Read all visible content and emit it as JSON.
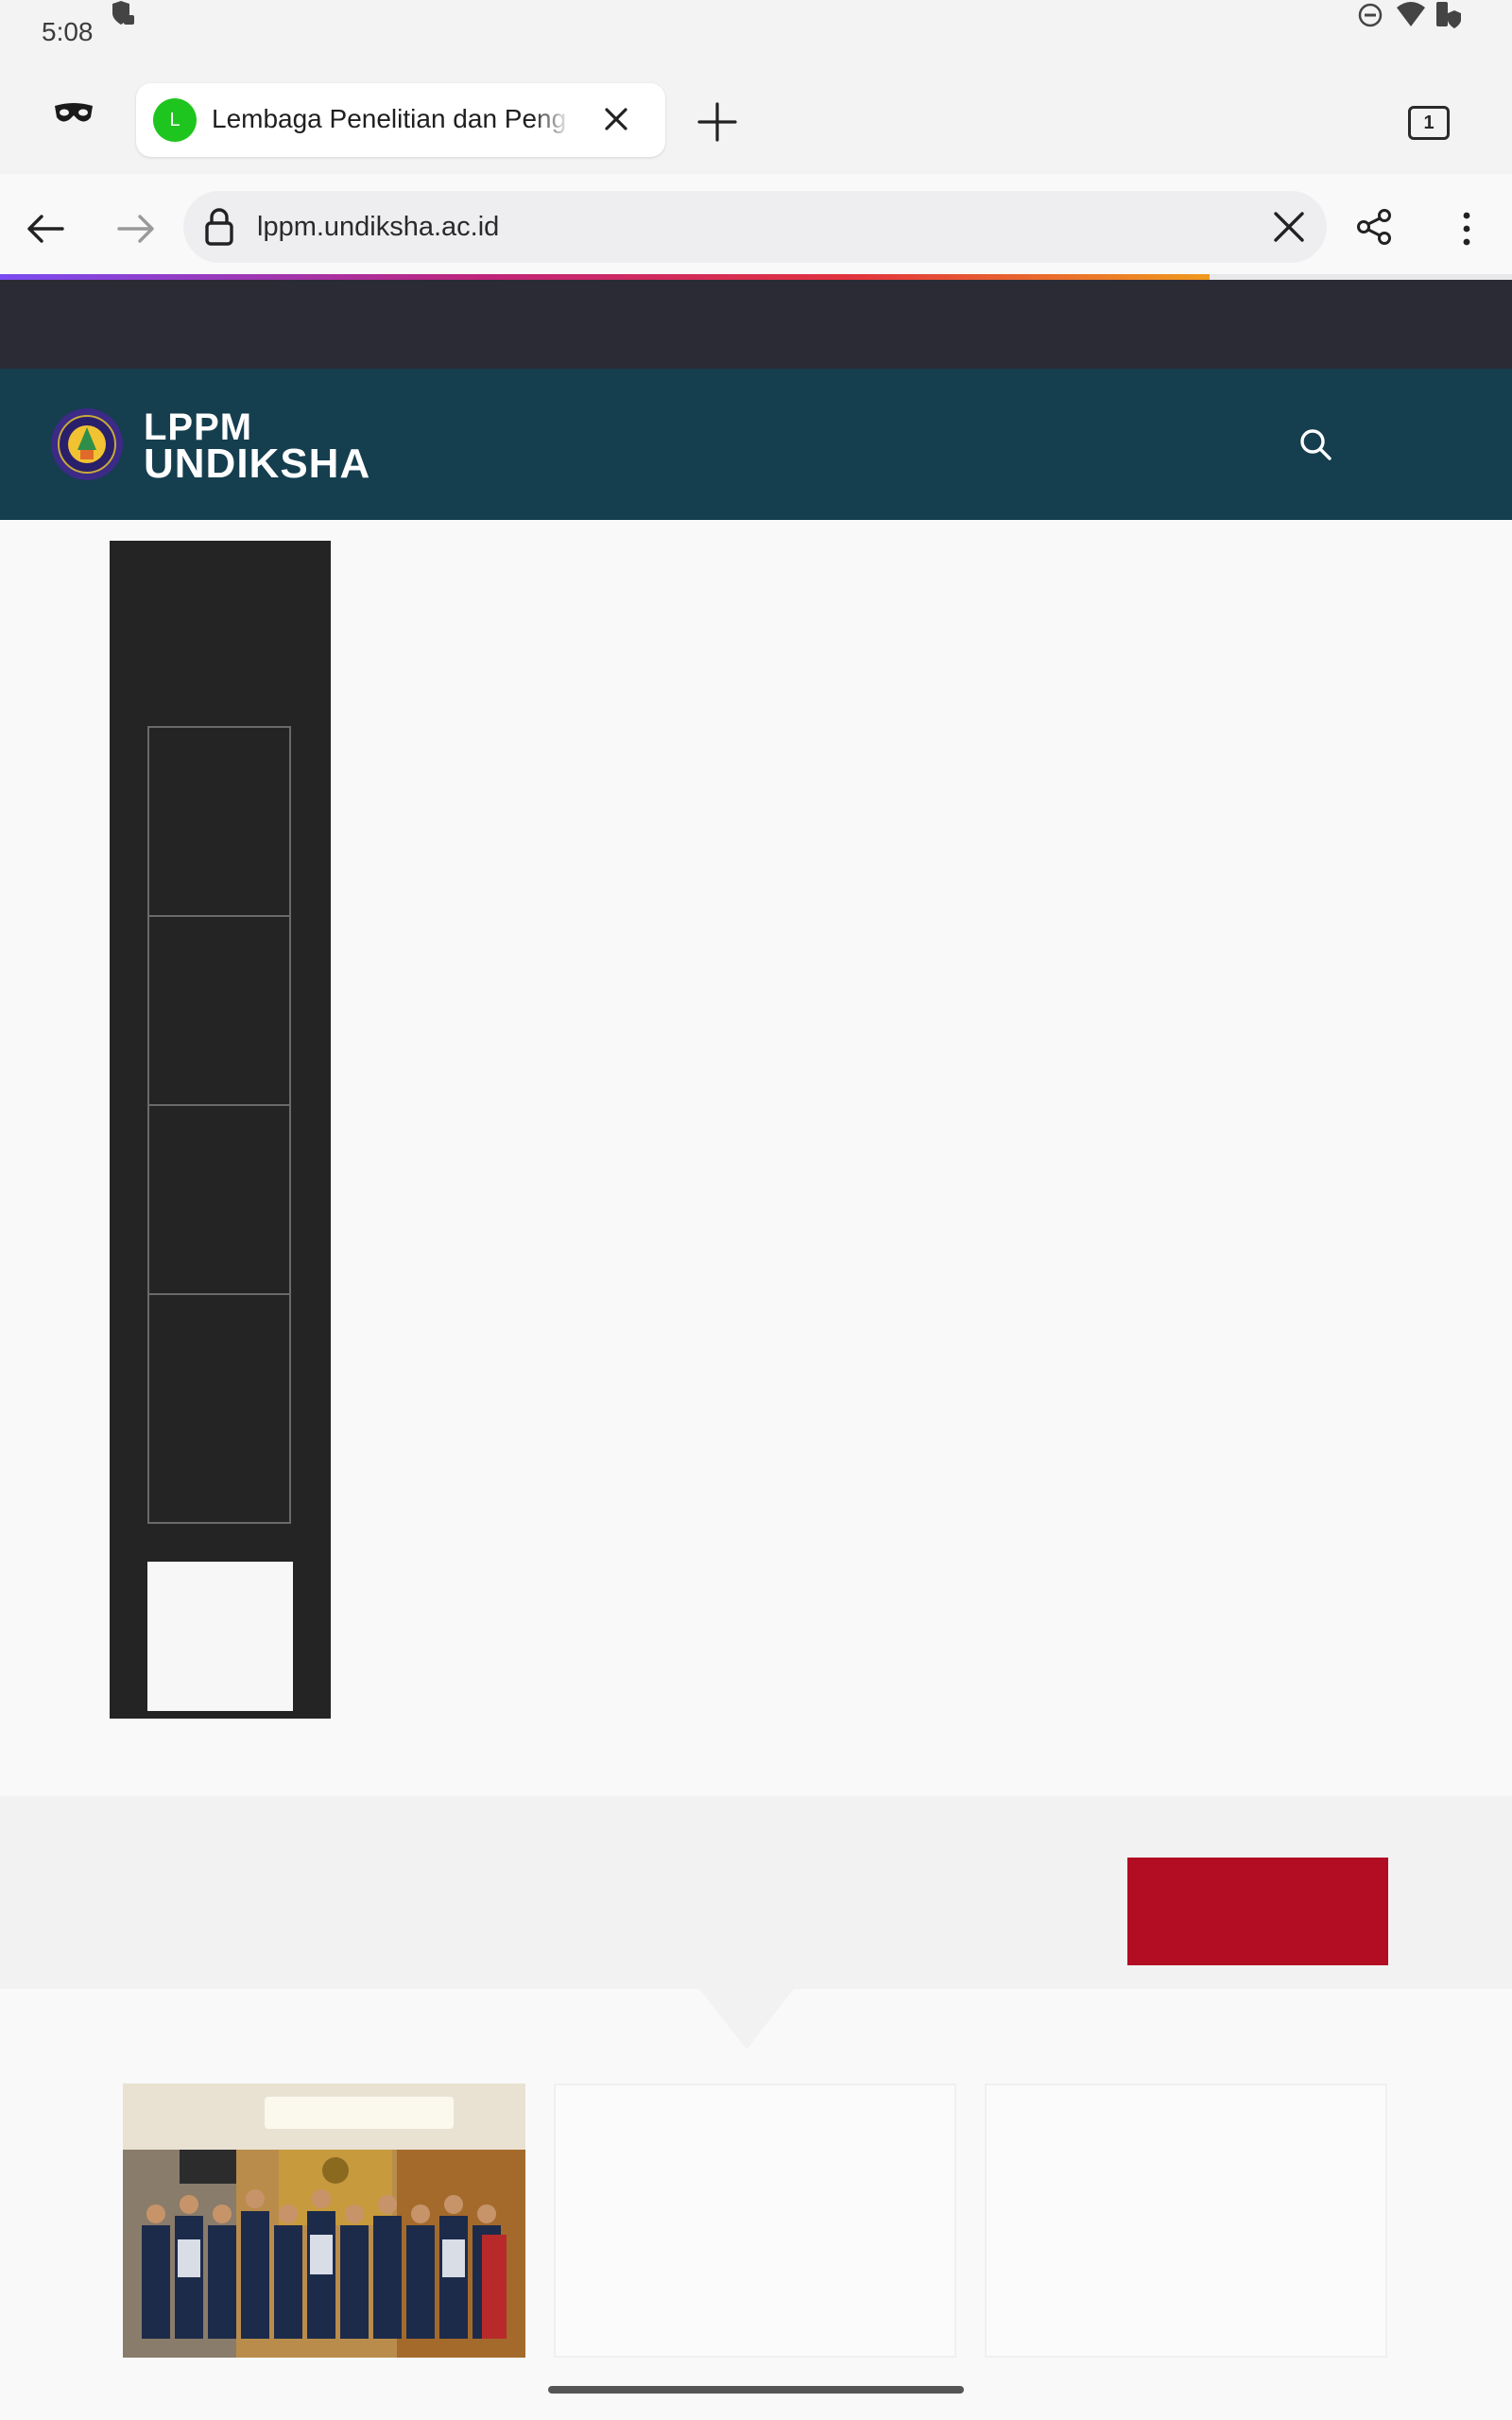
{
  "status_bar": {
    "time": "5:08",
    "icons": [
      "shield-lock-icon",
      "do-not-disturb-icon",
      "wifi-icon",
      "battery-shield-icon"
    ]
  },
  "browser": {
    "incognito_icon": "incognito-mask-icon",
    "tab": {
      "favicon_letter": "L",
      "favicon_color": "#1fc51f",
      "title": "Lembaga Penelitian dan Peng"
    },
    "tab_count": "1",
    "url": "lppm.undiksha.ac.id",
    "progress": 0.8
  },
  "site": {
    "logo_line1": "LPPM",
    "logo_line2": "UNDIKSHA",
    "header_color": "#153e4f",
    "top_bar_color": "#2b2b36",
    "accent_red": "#b20d22"
  }
}
